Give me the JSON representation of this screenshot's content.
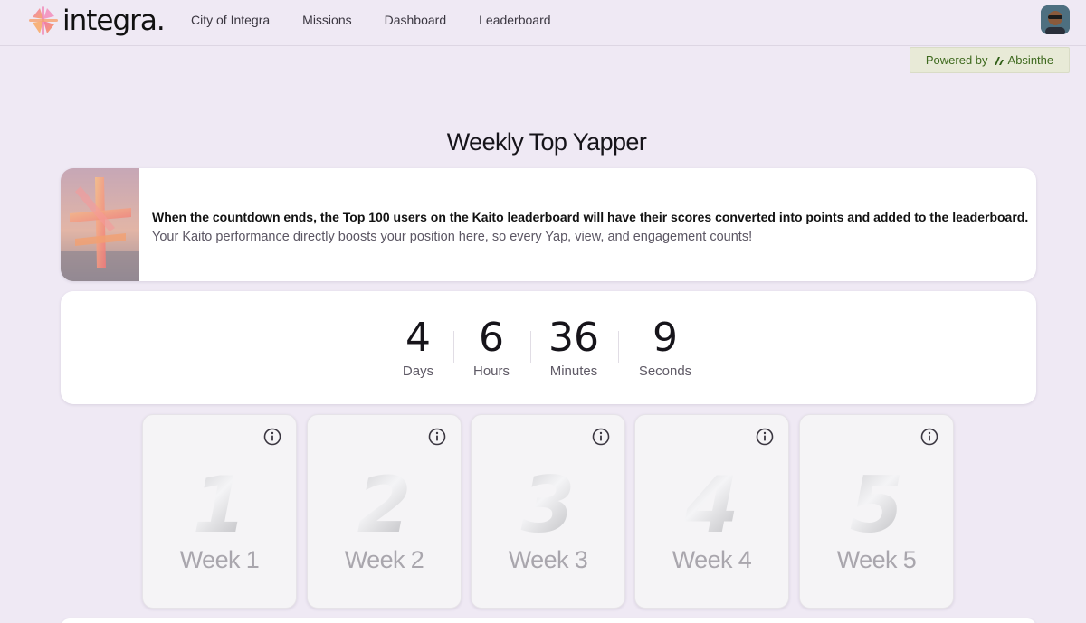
{
  "nav": {
    "logo_text": "integra.",
    "links": [
      "City of Integra",
      "Missions",
      "Dashboard",
      "Leaderboard"
    ]
  },
  "powered": {
    "prefix": "Powered by",
    "brand": "Absinthe"
  },
  "page": {
    "title": "Weekly Top Yapper"
  },
  "banner": {
    "line1": "When the countdown ends, the Top 100 users on the Kaito leaderboard will have their scores converted into points and added to the leaderboard.",
    "line2": "Your Kaito performance directly boosts your position here, so every Yap, view, and engagement counts!"
  },
  "countdown": {
    "days": "4",
    "days_label": "Days",
    "hours": "6",
    "hours_label": "Hours",
    "minutes": "36",
    "minutes_label": "Minutes",
    "seconds": "9",
    "seconds_label": "Seconds"
  },
  "weeks": [
    {
      "number": "1",
      "label": "Week 1"
    },
    {
      "number": "2",
      "label": "Week 2"
    },
    {
      "number": "3",
      "label": "Week 3"
    },
    {
      "number": "4",
      "label": "Week 4"
    },
    {
      "number": "5",
      "label": "Week 5"
    }
  ],
  "icons": {
    "logo": "integra-logo-icon",
    "info": "info-icon",
    "avatar": "user-avatar",
    "brand": "absinthe-logo-icon"
  },
  "colors": {
    "background": "#efe9f4",
    "powered_text": "#3f6a1f",
    "logo_pink": "#f06aa0",
    "logo_orange": "#f7a35c"
  }
}
